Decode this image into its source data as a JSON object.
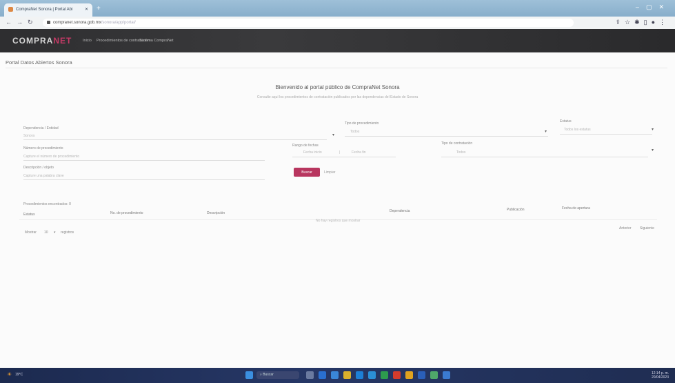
{
  "browser": {
    "tab_title": "CompraNet Sonora | Portal Abi",
    "new_tab": "+",
    "url_host": "compranet.sonora.gob.mx",
    "url_path": "/sonora/app/portal/"
  },
  "site": {
    "logo_main": "COMPRA",
    "logo_accent": "NET",
    "nav": [
      "Inicio",
      "Procedimientos de contratación",
      "Sistema CompraNet"
    ]
  },
  "portal": {
    "title": "Portal Datos Abiertos Sonora",
    "welcome": "Bienvenido al portal público de CompraNet Sonora",
    "welcome_sub": "Consulte aquí los procedimientos de contratación publicados por las dependencias del Estado de Sonora"
  },
  "filters": {
    "dependency_label": "Dependencia / Entidad",
    "dependency_value": "Sonora",
    "procedure_type_label": "Tipo de procedimiento",
    "procedure_type_value": "Todos",
    "status_label": "Estatus",
    "status_value": "Todos los estatus",
    "number_label": "Número de procedimiento",
    "number_placeholder": "Capture el número de procedimiento",
    "date_range_label": "Rango de fechas",
    "date_from": "Fecha inicio",
    "date_to": "Fecha fin",
    "contract_type_label": "Tipo de contratación",
    "contract_type_value": "Todos",
    "description_label": "Descripción / objeto",
    "description_placeholder": "Capture una palabra clave",
    "search_button": "Buscar",
    "clear_button": "Limpiar"
  },
  "results": {
    "summary": "Procedimientos encontrados: 0",
    "columns": [
      "Estatus",
      "No. de procedimiento",
      "Descripción",
      "Dependencia",
      "Publicación",
      "Fecha de apertura"
    ],
    "empty_message": "No hay registros que mostrar",
    "page_size_label": "Mostrar",
    "page_size_value": "10",
    "page_size_suffix": "registros",
    "prev": "Anterior",
    "next": "Siguiente"
  },
  "taskbar": {
    "search_placeholder": "Buscar",
    "weather": "19°C",
    "time": "12:14 p. m.",
    "date": "20/04/2023",
    "accent": "#b8365f"
  }
}
